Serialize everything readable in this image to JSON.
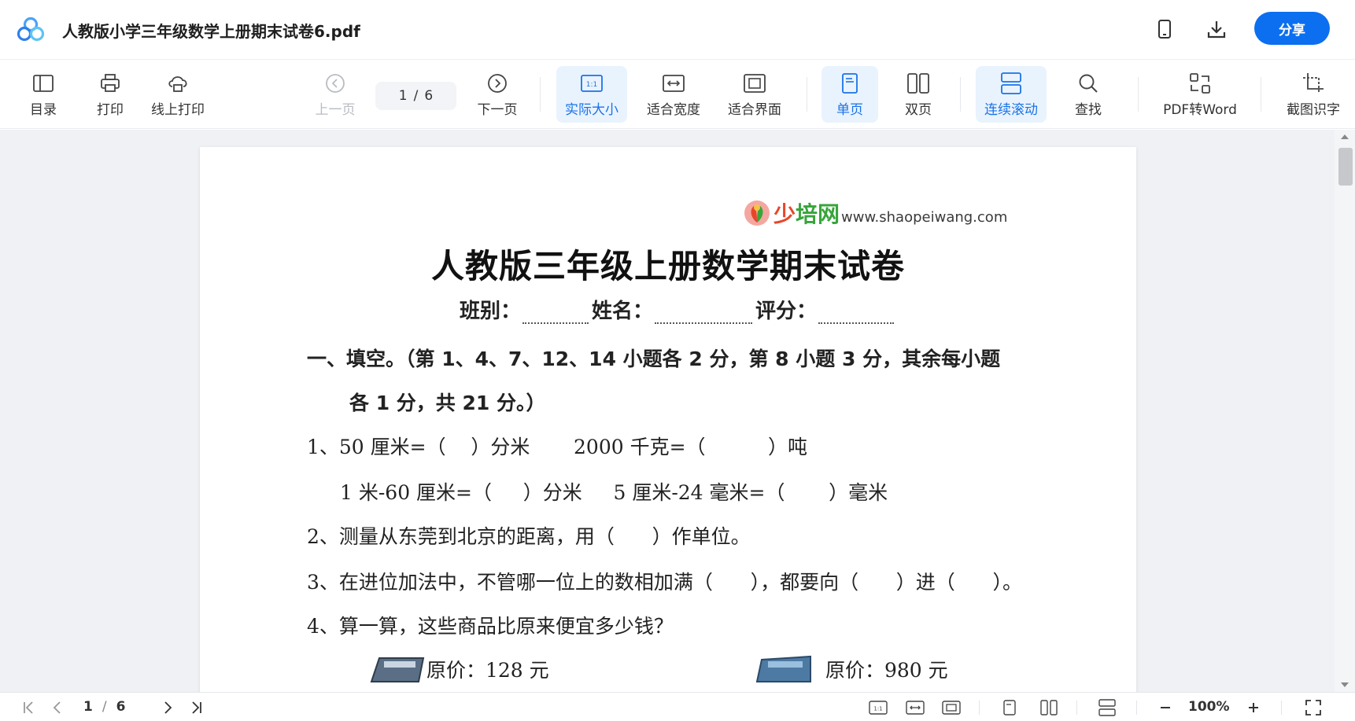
{
  "titlebar": {
    "doc_title": "人教版小学三年级数学上册期末试卷6.pdf",
    "icons": [
      "app-logo",
      "phone-icon",
      "download-icon"
    ],
    "share_label": "分享",
    "accent_color": "#0b6ff0"
  },
  "toolbar": {
    "toc": "目录",
    "print": "打印",
    "online_print": "线上打印",
    "prev_page": "上一页",
    "current_page": "1",
    "page_sep": "/",
    "total_pages": "6",
    "next_page": "下一页",
    "actual_size": "实际大小",
    "fit_width": "适合宽度",
    "fit_page": "适合界面",
    "single_page": "单页",
    "double_page": "双页",
    "continuous_scroll": "连续滚动",
    "find": "查找",
    "pdf_to_word": "PDF转Word",
    "screenshot_ocr": "截图识字",
    "active_items": [
      "实际大小",
      "单页",
      "连续滚动"
    ]
  },
  "document": {
    "brand_text_a": "少",
    "brand_text_b": "培网",
    "brand_url": "www.shaopeiwang.com",
    "title": "人教版三年级上册数学期末试卷",
    "class_label": "班别：",
    "name_label": "姓名：",
    "score_label": "评分：",
    "section1": "一、填空。（第 1、4、7、12、14 小题各 2 分，第 8 小题 3 分，其余每小题",
    "section1_cont": "各 1 分，共 21 分。）",
    "q1a": "1、50 厘米=（    ）分米       2000 千克=（          ）吨",
    "q1b": "1 米-60 厘米=（     ）分米     5 厘米-24 毫米=（       ）毫米",
    "q2": "2、测量从东莞到北京的距离，用（      ）作单位。",
    "q3": "3、在进位加法中，不管哪一位上的数相加满（      ），都要向（      ）进（      ）。",
    "q4": "4、算一算，这些商品比原来便宜多少钱？",
    "price1": "原价：128 元",
    "price2": "原价：980 元"
  },
  "statusbar": {
    "current_page": "1",
    "page_sep": "/",
    "total_pages": "6",
    "zoom": "100%"
  }
}
